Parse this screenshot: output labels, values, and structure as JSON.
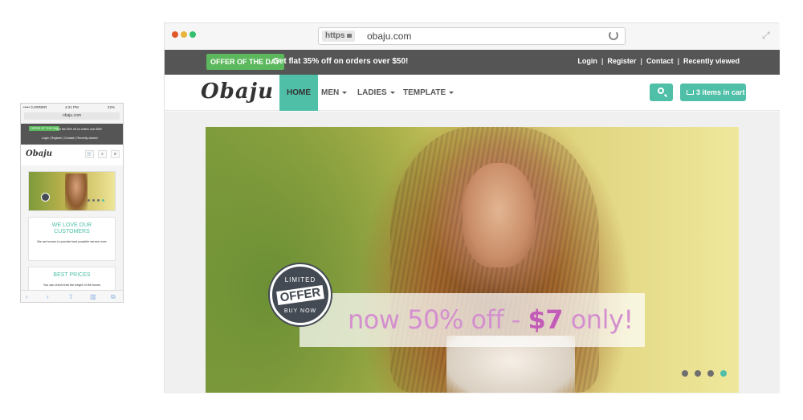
{
  "desktop": {
    "browser": {
      "protocol": "https",
      "url": "obaju.com"
    },
    "topbar": {
      "offer_badge": "OFFER OF THE DAY",
      "offer_text": "Get flat 35% off on orders over $50!",
      "links": [
        "Login",
        "Register",
        "Contact",
        "Recently viewed"
      ]
    },
    "navbar": {
      "logo": "Obaju",
      "items": [
        {
          "label": "HOME",
          "active": true
        },
        {
          "label": "MEN",
          "dropdown": true
        },
        {
          "label": "LADIES",
          "dropdown": true
        },
        {
          "label": "TEMPLATE",
          "dropdown": true
        }
      ],
      "cart_label": "3 items in cart"
    },
    "hero": {
      "badge": {
        "top": "LIMITED",
        "middle": "OFFER",
        "bottom": "BUY NOW"
      },
      "banner_prefix": "now 50% off - ",
      "banner_price": "$7",
      "banner_suffix": " only!",
      "slide_count": 4,
      "active_slide": 4
    },
    "colors": {
      "accent": "#4fbfa8",
      "offer_green": "#5cb85c",
      "topbar_bg": "#555555",
      "promo_pink": "#c35bb8"
    }
  },
  "mobile": {
    "status": {
      "carrier": "••••• CARRIER",
      "time": "4:21 PM",
      "battery": "22%"
    },
    "url": "obaju.com",
    "topbar": {
      "offer_badge": "OFFER OF THE DAY",
      "offer_text": "Get flat 35% off on orders over $50!",
      "links": "Login  |  Register  |  Contact  |  Recently viewed"
    },
    "logo": "Obaju",
    "box1": {
      "title": "WE LOVE OUR CUSTOMERS",
      "text": "We are known to provide best possible service ever"
    },
    "box2": {
      "title": "BEST PRICES",
      "text": "You can check that the height of the boxes"
    }
  }
}
